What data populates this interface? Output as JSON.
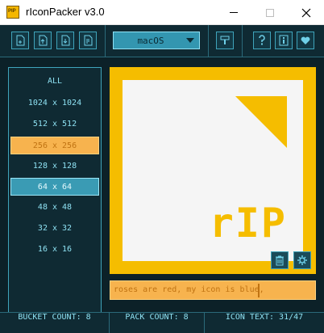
{
  "window": {
    "title": "rIconPacker v3.0",
    "app_icon_text": "PIP"
  },
  "toolbar": {
    "buttons": [
      "new-file-icon",
      "open-file-icon",
      "save-file-icon",
      "export-file-icon",
      "style-paint-icon",
      "help-icon",
      "info-icon",
      "heart-icon"
    ],
    "platform_selected": "macOS"
  },
  "sizes": {
    "items": [
      {
        "label": "ALL"
      },
      {
        "label": "1024 x 1024"
      },
      {
        "label": "512 x 512"
      },
      {
        "label": "256 x 256"
      },
      {
        "label": "128 x 128"
      },
      {
        "label": "64 x 64"
      },
      {
        "label": "48 x 48"
      },
      {
        "label": "32 x 32"
      },
      {
        "label": "16 x 16"
      }
    ],
    "hover_label": "256 x 256",
    "selected_label": "64 x 64"
  },
  "preview": {
    "logo_text": "rIP"
  },
  "icon_text": {
    "value": "roses are red, my icon is blue,"
  },
  "status": {
    "bucket": "BUCKET COUNT: 8",
    "pack": "PACK COUNT: 8",
    "icon_text": "ICON TEXT: 31/47"
  },
  "colors": {
    "bg": "#0c2128",
    "border": "#3fa4bb",
    "accent": "#3a9bb4",
    "highlight": "#f7b34e",
    "logo": "#f5bd00"
  }
}
